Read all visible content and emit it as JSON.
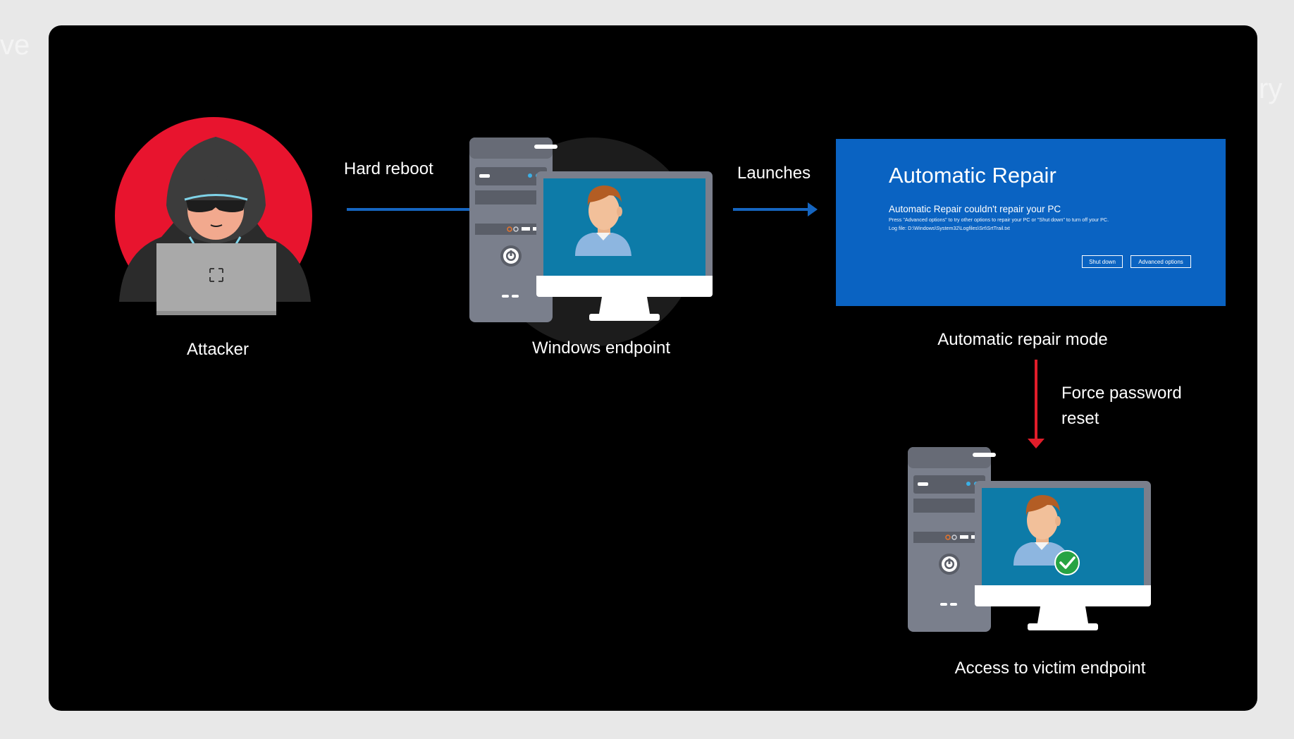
{
  "background_text": {
    "left": "ve",
    "right": "ry"
  },
  "colors": {
    "panel": "#000000",
    "attacker_circle": "#e8142e",
    "arrow_blue": "#1565c0",
    "arrow_red": "#e11d2a",
    "repair_bg": "#0a63c2",
    "check_green": "#27a343"
  },
  "labels": {
    "attacker": "Attacker",
    "hard_reboot": "Hard reboot",
    "windows_endpoint": "Windows endpoint",
    "launches": "Launches",
    "automatic_repair_mode": "Automatic repair mode",
    "force_password_reset_line1": "Force password",
    "force_password_reset_line2": "reset",
    "access_to_victim": "Access to victim endpoint"
  },
  "repair_screen": {
    "title": "Automatic Repair",
    "subtitle": "Automatic Repair couldn't repair your PC",
    "line1": "Press \"Advanced options\" to try other options to repair your PC or \"Shut down\" to turn off your PC.",
    "line2": "Log file: D:\\Windows\\System32\\Logfiles\\Srt\\SrtTrail.txt",
    "btn_shutdown": "Shut down",
    "btn_advanced": "Advanced options"
  },
  "icons": {
    "attacker": "hooded-hacker-with-laptop-icon",
    "endpoint": "desktop-computer-with-user-icon",
    "victim": "desktop-computer-with-user-check-icon"
  }
}
